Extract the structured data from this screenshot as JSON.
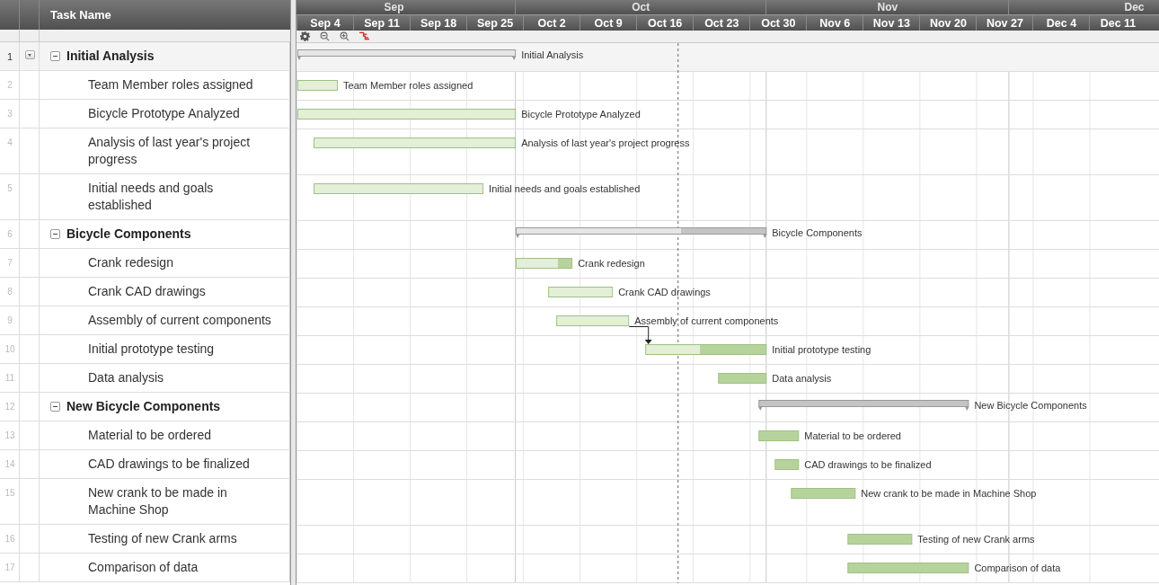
{
  "header": {
    "task_column": "Task Name"
  },
  "tasks": [
    {
      "number": "1",
      "name": "Initial Analysis",
      "kind": "summary",
      "expanded": true,
      "selected": true,
      "level": 1,
      "bar_label": "Initial Analysis"
    },
    {
      "number": "2",
      "name": "Team Member roles assigned",
      "kind": "task",
      "selected": false,
      "level": 1,
      "bar_label": "Team Member roles assigned"
    },
    {
      "number": "3",
      "name": "Bicycle Prototype Analyzed",
      "kind": "task",
      "selected": false,
      "level": 1,
      "bar_label": "Bicycle Prototype Analyzed"
    },
    {
      "number": "4",
      "name": "Analysis of last year's project progress",
      "kind": "task",
      "selected": false,
      "level": 1,
      "bar_label": "Analysis of last year's project progress"
    },
    {
      "number": "5",
      "name": "Initial needs and goals established",
      "kind": "task",
      "selected": false,
      "level": 1,
      "bar_label": "Initial needs and goals established"
    },
    {
      "number": "6",
      "name": "Bicycle Components",
      "kind": "summary",
      "expanded": true,
      "selected": false,
      "level": 0.66,
      "bar_label": "Bicycle Components"
    },
    {
      "number": "7",
      "name": "Crank redesign",
      "kind": "task",
      "selected": false,
      "level": 0.75,
      "bar_label": "Crank redesign"
    },
    {
      "number": "8",
      "name": "Crank CAD drawings",
      "kind": "task",
      "selected": false,
      "level": 1,
      "bar_label": "Crank CAD drawings"
    },
    {
      "number": "9",
      "name": "Assembly of current components",
      "kind": "task",
      "selected": false,
      "level": 1,
      "bar_label": "Assembly of current components"
    },
    {
      "number": "10",
      "name": "Initial prototype testing",
      "kind": "task",
      "selected": false,
      "depends_on_previous": true,
      "level": 0.45,
      "bar_label": "Initial prototype testing"
    },
    {
      "number": "11",
      "name": "Data analysis",
      "kind": "task",
      "selected": false,
      "bar_label": "Data analysis"
    },
    {
      "number": "12",
      "name": "New Bicycle Components",
      "kind": "summary",
      "expanded": true,
      "selected": false,
      "bar_label": "New Bicycle Components"
    },
    {
      "number": "13",
      "name": "Material to be ordered",
      "kind": "task",
      "selected": false,
      "bar_label": "Material to be ordered"
    },
    {
      "number": "14",
      "name": "CAD drawings to be finalized",
      "kind": "task",
      "selected": false,
      "bar_label": "CAD drawings to be finalized"
    },
    {
      "number": "15",
      "name": "New crank to be made in Machine Shop",
      "kind": "task",
      "selected": false,
      "bar_label": "New crank to be made in Machine Shop"
    },
    {
      "number": "16",
      "name": "Testing of new Crank arms",
      "kind": "task",
      "selected": false,
      "bar_label": "Testing of new Crank arms"
    },
    {
      "number": "17",
      "name": "Comparison of data",
      "kind": "task",
      "selected": false,
      "bar_label": "Comparison of data"
    }
  ],
  "gantt": {
    "months": [
      "Sep",
      "Oct",
      "Nov",
      "Dec"
    ],
    "weeks": [
      "Sep 4",
      "Sep 11",
      "Sep 18",
      "Sep 25",
      "Oct 2",
      "Oct 9",
      "Oct 16",
      "Oct 23",
      "Oct 30",
      "Nov 6",
      "Nov 13",
      "Nov 20",
      "Nov 27",
      "Dec 4",
      "Dec 11"
    ]
  }
}
